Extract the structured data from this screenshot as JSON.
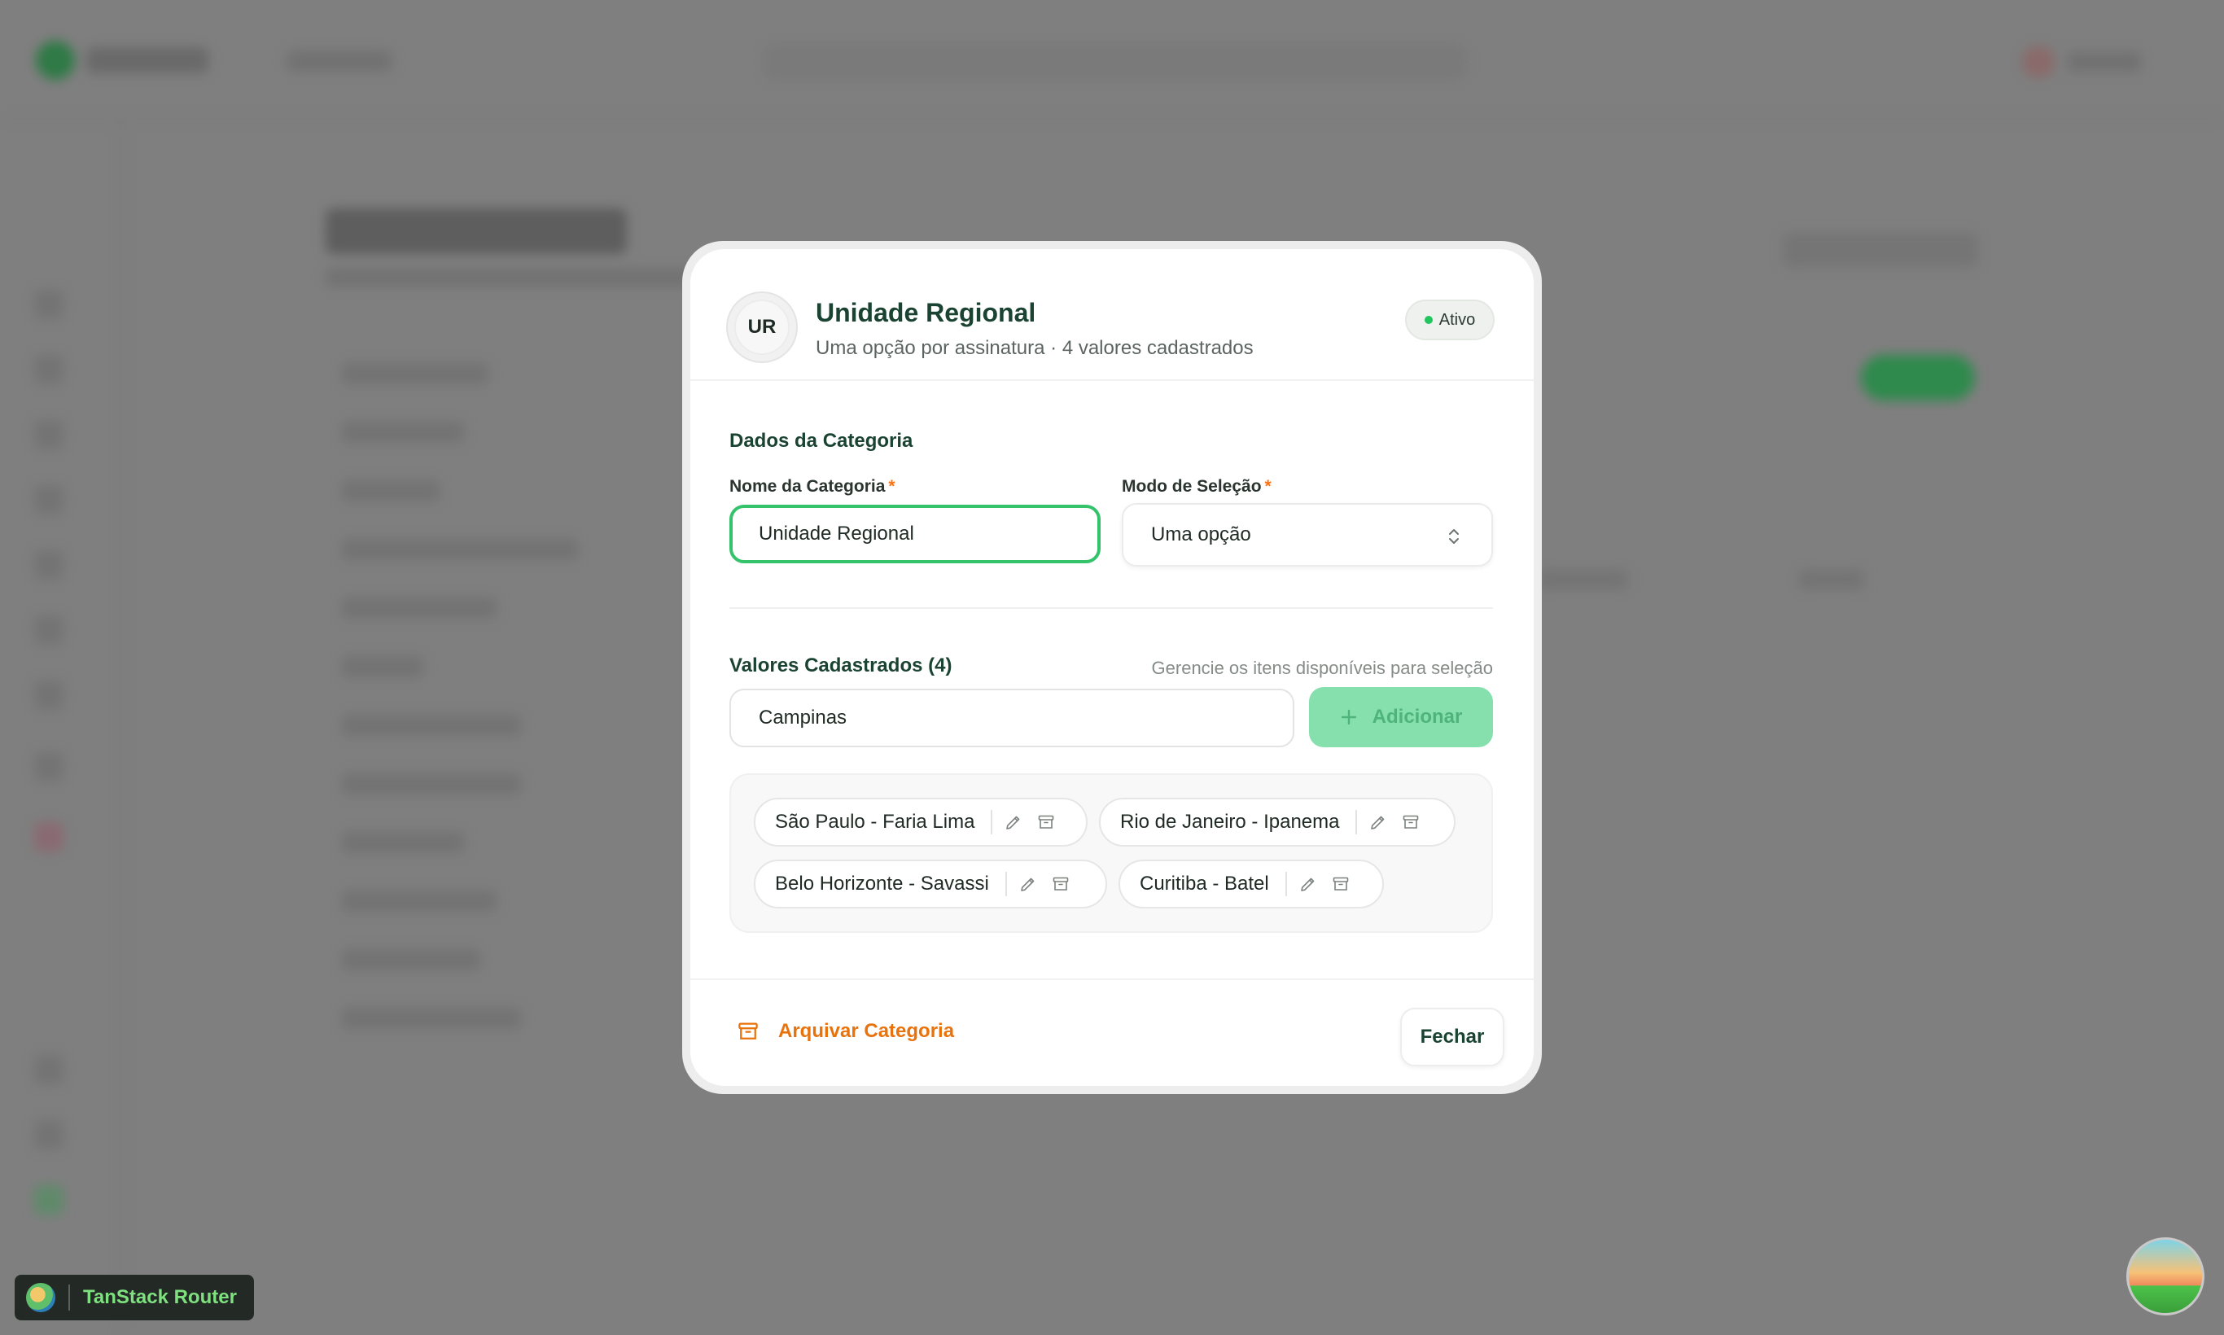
{
  "background_app": {},
  "modal": {
    "avatar_initials": "UR",
    "title": "Unidade Regional",
    "subtitle": "Uma opção por assinatura · 4 valores cadastrados",
    "status_badge": "Ativo",
    "section_category": "Dados da Categoria",
    "name_label": "Nome da Categoria",
    "name_value": "Unidade Regional",
    "mode_label": "Modo de Seleção",
    "mode_value": "Uma opção",
    "required_mark": "*",
    "values_title": "Valores Cadastrados (4)",
    "values_hint": "Gerencie os itens disponíveis para seleção",
    "new_value_input": "Campinas",
    "add_button": "Adicionar",
    "values": [
      "São Paulo - Faria Lima",
      "Rio de Janeiro - Ipanema",
      "Belo Horizonte - Savassi",
      "Curitiba - Batel"
    ],
    "archive_button": "Arquivar Categoria",
    "close_button": "Fechar"
  },
  "devtools": {
    "label": "TanStack Router"
  },
  "colors": {
    "primary_dark": "#1b4332",
    "accent_green": "#34c26a",
    "add_button_bg": "#86e0ad",
    "archive_orange": "#e8720c",
    "status_dot": "#22c55e",
    "overlay": "#7f7f7f"
  },
  "icons": {
    "select": "chevron-up-down-icon",
    "add": "plus-icon",
    "edit": "pencil-icon",
    "archive": "archive-box-icon"
  }
}
